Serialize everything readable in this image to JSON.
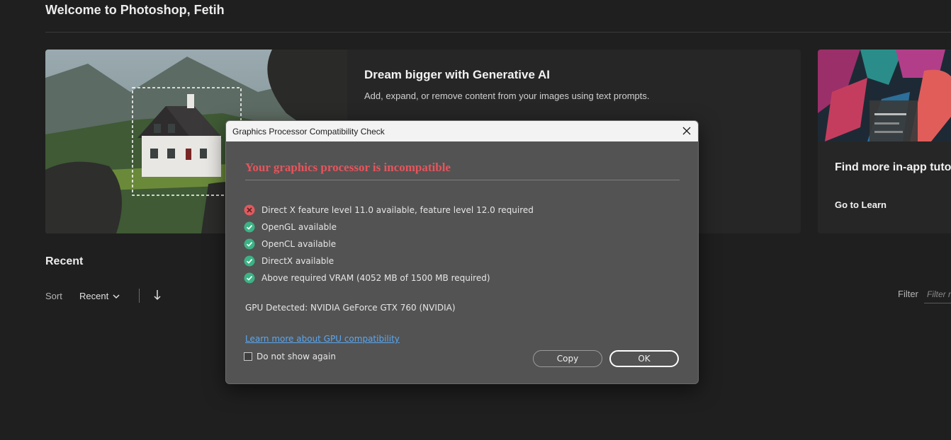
{
  "app": {
    "welcome": "Welcome to Photoshop, Fetih"
  },
  "hero": {
    "title": "Dream bigger with Generative AI",
    "subtitle": "Add, expand, or remove content from your images using text prompts."
  },
  "learn": {
    "title": "Find more in-app tuto",
    "link": "Go to Learn"
  },
  "recent": {
    "heading": "Recent",
    "sort_label": "Sort",
    "sort_value": "Recent",
    "filter_label": "Filter",
    "filter_placeholder": "Filter r"
  },
  "dialog": {
    "title": "Graphics Processor Compatibility Check",
    "heading": "Your graphics processor is incompatible",
    "checks": [
      {
        "status": "fail",
        "text": "Direct X feature level 11.0 available, feature level 12.0 required"
      },
      {
        "status": "pass",
        "text": "OpenGL available"
      },
      {
        "status": "pass",
        "text": "OpenCL available"
      },
      {
        "status": "pass",
        "text": "DirectX available"
      },
      {
        "status": "pass",
        "text": "Above required VRAM (4052 MB of 1500 MB required)"
      }
    ],
    "gpu_detected": "GPU Detected: NVIDIA GeForce GTX 760 (NVIDIA)",
    "learn_link": "Learn more about GPU compatibility",
    "do_not_show": "Do not show again",
    "copy_button": "Copy",
    "ok_button": "OK"
  },
  "colors": {
    "fail": "#e05a5e",
    "pass": "#3bb386",
    "heading": "#e8545c",
    "link": "#5aa7f0"
  },
  "icons": {
    "fail": "x-circle-icon",
    "pass": "check-circle-icon",
    "close": "close-icon"
  }
}
